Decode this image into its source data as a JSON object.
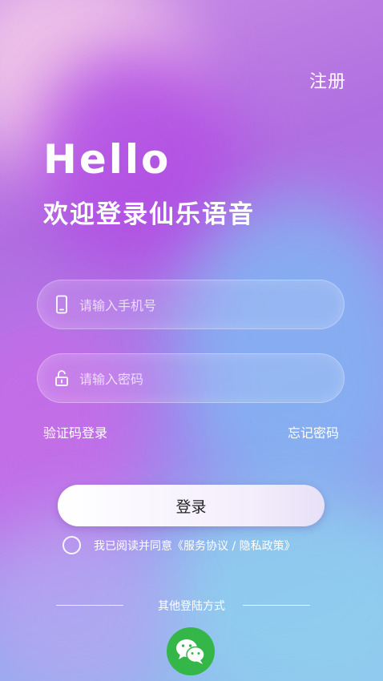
{
  "header": {
    "register_label": "注册"
  },
  "hero": {
    "greeting": "Hello",
    "subtitle": "欢迎登录仙乐语音"
  },
  "form": {
    "phone": {
      "placeholder": "请输入手机号",
      "icon": "phone-icon"
    },
    "password": {
      "placeholder": "请输入密码",
      "icon": "lock-icon"
    },
    "sms_login_label": "验证码登录",
    "forgot_password_label": "忘记密码",
    "login_button_label": "登录"
  },
  "agreement": {
    "prefix": "我已阅读并同意",
    "policy_text": "《服务协议 / 隐私政策》"
  },
  "other_login": {
    "title": "其他登陆方式",
    "methods": [
      {
        "name": "wechat",
        "icon": "wechat-icon",
        "color": "#35b648"
      }
    ]
  }
}
